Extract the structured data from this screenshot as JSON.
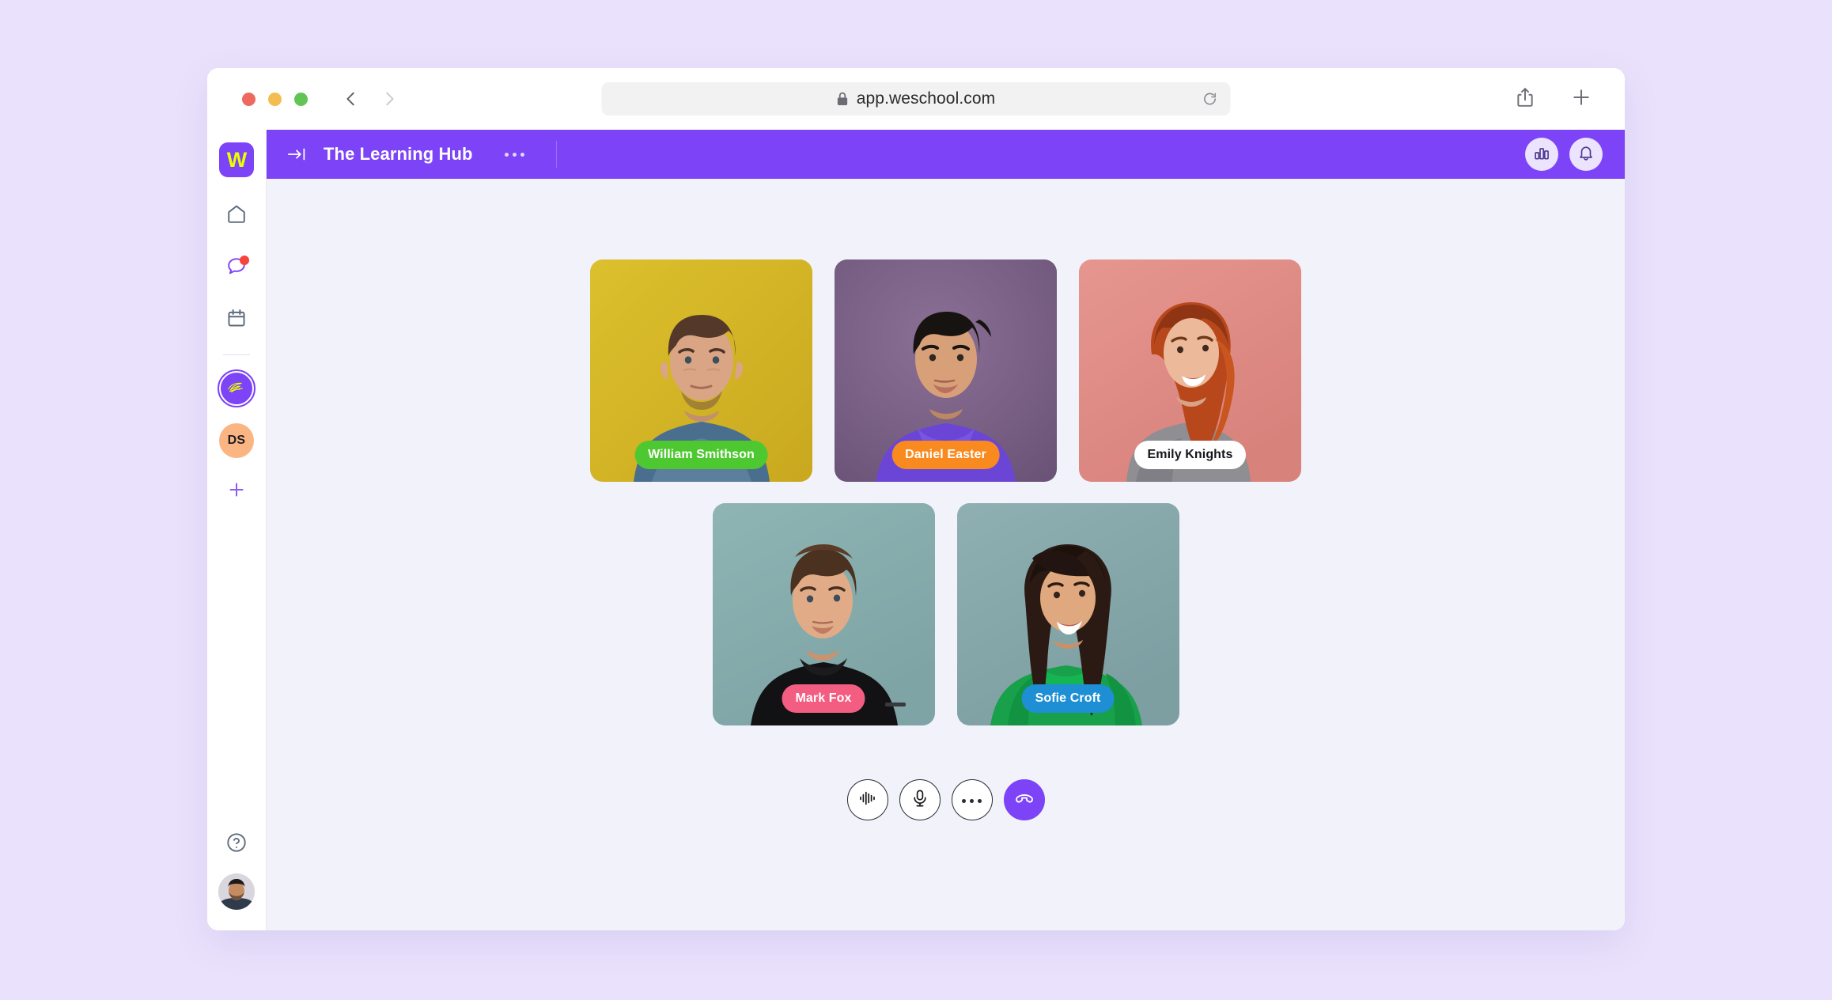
{
  "browser": {
    "url": "app.weschool.com",
    "lock_icon": "lock-icon",
    "reload_icon": "reload-icon",
    "back_icon": "back-arrow-icon",
    "forward_icon": "forward-arrow-icon",
    "share_icon": "share-icon",
    "newtab_icon": "plus-icon",
    "traffic_lights": [
      "close-red",
      "minimize-yellow",
      "maximize-green"
    ]
  },
  "rail": {
    "logo_letter": "W",
    "items": [
      {
        "name": "home",
        "icon": "home-icon",
        "active": false,
        "badge": false
      },
      {
        "name": "chat",
        "icon": "chat-bubble-icon",
        "active": true,
        "badge": true
      },
      {
        "name": "calendar",
        "icon": "calendar-icon",
        "active": false,
        "badge": false
      }
    ],
    "group_avatar": {
      "name": "learning-hub-group",
      "icon": "signature-scribble-icon",
      "active": true
    },
    "ds_avatar_initials": "DS",
    "add_label": "plus-icon",
    "help_icon": "help-circle-icon",
    "user_avatar": "user-profile-photo"
  },
  "topbar": {
    "collapse_icon": "collapse-sidebar-icon",
    "title": "The Learning Hub",
    "more_icon": "more-options-icon",
    "analytics_icon": "analytics-bar-chart-icon",
    "bell_icon": "notification-bell-icon"
  },
  "call": {
    "participants": [
      {
        "name": "William Smithson",
        "pill_bg": "#4ec831",
        "pill_text": "#ffffff",
        "bg": "#d4b62a"
      },
      {
        "name": "Daniel Easter",
        "pill_bg": "#f98a1f",
        "pill_text": "#ffffff",
        "bg": "#7d6287"
      },
      {
        "name": "Emily Knights",
        "pill_bg": "#ffffff",
        "pill_text": "#15151c",
        "bg": "#e08d87"
      },
      {
        "name": "Mark Fox",
        "pill_bg": "#f45d82",
        "pill_text": "#ffffff",
        "bg": "#86aeae"
      },
      {
        "name": "Sofie Croft",
        "pill_bg": "#1e8fd5",
        "pill_text": "#ffffff",
        "bg": "#86a6a8"
      }
    ],
    "controls": [
      {
        "name": "audio-levels-button",
        "icon": "waveform-icon"
      },
      {
        "name": "microphone-button",
        "icon": "microphone-icon"
      },
      {
        "name": "more-options-button",
        "icon": "ellipsis-icon"
      },
      {
        "name": "end-call-button",
        "icon": "hangup-phone-icon"
      }
    ]
  },
  "colors": {
    "brand_purple": "#7c43f7",
    "page_bg": "#eae2fc",
    "stage_bg": "#f2f2fb",
    "logo_yellow": "#eaff00",
    "badge_red": "#f8423c"
  }
}
